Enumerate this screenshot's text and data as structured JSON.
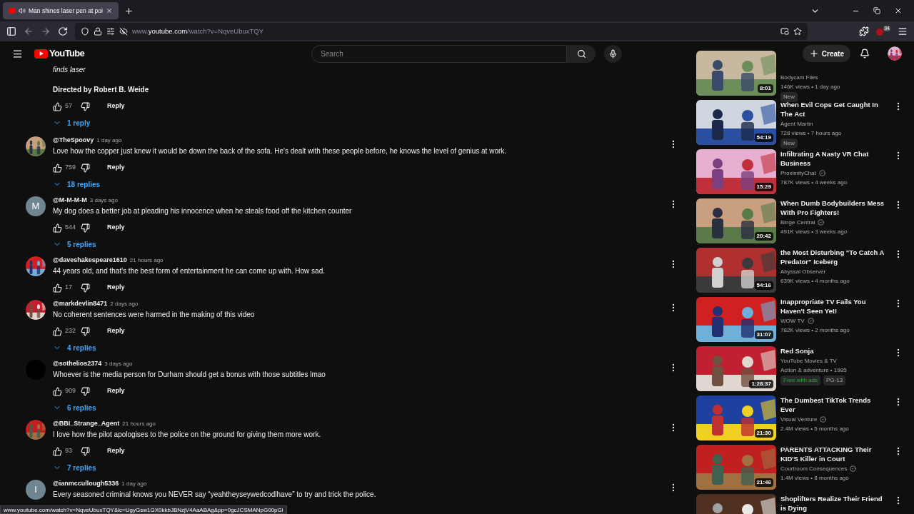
{
  "browser": {
    "tab": {
      "title": "Man shines laser pen at poi",
      "selected": true
    },
    "url_host": "www.",
    "url_domain": "youtube.com",
    "url_path": "/watch?v=NqveUbuxTQY",
    "extension_badge": "34"
  },
  "header": {
    "logo": "YouTube",
    "search": {
      "placeholder": "Search"
    },
    "create": "Create"
  },
  "partial_comment": {
    "text": "finds laser",
    "credit": "Directed by Robert B. Weide",
    "likes": "57",
    "reply": "Reply",
    "replies": "1 reply"
  },
  "comments": [
    {
      "author": "@TheSpoovy",
      "time": "1 day ago",
      "text": "Love how the copper just knew it would be down the back of the sofa. He's dealt with these people before, he knows the level of genius at work.",
      "likes": "759",
      "reply": "Reply",
      "replies": "18 replies"
    },
    {
      "author": "@M-M-M-M",
      "time": "3 days ago",
      "avatar": {
        "kind": "letter",
        "letter": "M"
      },
      "text": "My dog does a better job at pleading his innocence when he steals food off the kitchen counter",
      "likes": "544",
      "reply": "Reply",
      "replies": "5 replies"
    },
    {
      "author": "@daveshakespeare1610",
      "time": "21 hours ago",
      "text": "44 years old, and that's the best form of entertainment he can come up with. How sad.",
      "likes": "17",
      "reply": "Reply"
    },
    {
      "author": "@markdevlin8471",
      "time": "2 days ago",
      "text": "No coherent sentences were harmed in the making of this video",
      "likes": "232",
      "reply": "Reply",
      "replies": "4 replies"
    },
    {
      "author": "@sothelios2374",
      "time": "3 days ago",
      "avatar": {
        "kind": "blank"
      },
      "text": "Whoever is the media person for Durham should get a bonus with those subtitles lmao",
      "likes": "909",
      "reply": "Reply",
      "replies": "6 replies"
    },
    {
      "author": "@BBI_Strange_Agent",
      "time": "21 hours ago",
      "text": "I love how the pilot apologises to the police on the ground for giving them more work.",
      "likes": "93",
      "reply": "Reply",
      "replies": "7 replies"
    },
    {
      "author": "@ianmccullough5336",
      "time": "1 day ago",
      "avatar": {
        "kind": "letter",
        "letter": "I"
      },
      "text": "Every seasoned criminal knows you NEVER say “yeahtheyseywedcodlhave” to try and trick the police."
    }
  ],
  "videos": [
    {
      "duration": "8:01",
      "channel": "Bodycam Files",
      "verified": false,
      "meta": "146K views • 1 day ago",
      "badges": [
        {
          "text": "New",
          "kind": "plain"
        }
      ]
    },
    {
      "title": "When Evil Cops Get Caught In The Act",
      "duration": "54:19",
      "channel": "Agent Martin",
      "verified": false,
      "meta": "728 views • 7 hours ago",
      "badges": [
        {
          "text": "New",
          "kind": "plain"
        }
      ]
    },
    {
      "title": "Infiltrating A Nasty VR Chat Business",
      "duration": "15:29",
      "channel": "ProximityChat",
      "verified": true,
      "meta": "787K views • 4 weeks ago"
    },
    {
      "title": "When Dumb Bodybuilders Mess With Pro Fighters!",
      "duration": "20:42",
      "channel": "Binge Central",
      "verified": true,
      "meta": "491K views • 3 weeks ago"
    },
    {
      "title": "the Most Disturbing \"To Catch A Predator\" Iceberg",
      "duration": "54:16",
      "channel": "Abyssal Observer",
      "verified": false,
      "meta": "639K views • 4 months ago"
    },
    {
      "title": "Inappropriate TV Fails You Haven't Seen Yet!",
      "duration": "31:07",
      "channel": "WOW TV",
      "verified": true,
      "meta": "782K views • 2 months ago"
    },
    {
      "title": "Red Sonja",
      "duration": "1:28:37",
      "channel": "YouTube Movies & TV",
      "verified": false,
      "meta": "Action & adventure • 1985",
      "badges": [
        {
          "text": "Free with ads",
          "kind": "green"
        },
        {
          "text": "PG-13",
          "kind": "plain"
        }
      ]
    },
    {
      "title": "The Dumbest TikTok Trends Ever",
      "duration": "21:30",
      "channel": "Visual Venture",
      "verified": true,
      "meta": "2.4M views • 5 months ago"
    },
    {
      "title": "PARENTS ATTACKING Their KID'S Killer in Court",
      "duration": "21:46",
      "channel": "Courtroom Consequences",
      "verified": true,
      "meta": "1.4M views • 8 months ago"
    },
    {
      "title": "Shoplifters Realize Their Friend is Dying"
    }
  ],
  "status_url": "www.youtube.com/watch?v=NqveUbuxTQY&lc=UgyGsw1GX0kkbJBNzjV4AaABAg&pp=0gcJCSMANpG00pGi"
}
